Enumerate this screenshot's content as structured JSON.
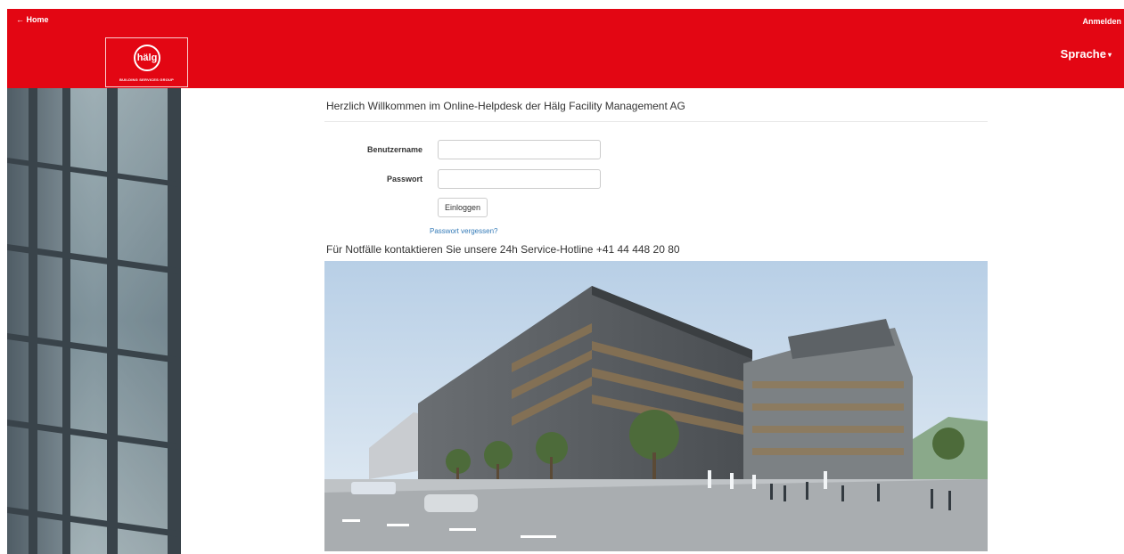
{
  "header": {
    "home_label": "← Home",
    "login_label": "Anmelden",
    "language_label": "Sprache",
    "logo_text": "hälg",
    "logo_tagline": "BUILDING SERVICES GROUP",
    "brand_color": "#e30613"
  },
  "main": {
    "welcome": "Herzlich Willkommen im Online-Helpdesk der Hälg Facility Management AG",
    "form": {
      "username_label": "Benutzername",
      "username_value": "",
      "password_label": "Passwort",
      "password_value": "",
      "submit_label": "Einloggen",
      "forgot_label": "Passwort vergessen?"
    },
    "hotline": "Für Notfälle kontaktieren Sie unsere 24h Service-Hotline +41 44 448 20 80"
  }
}
